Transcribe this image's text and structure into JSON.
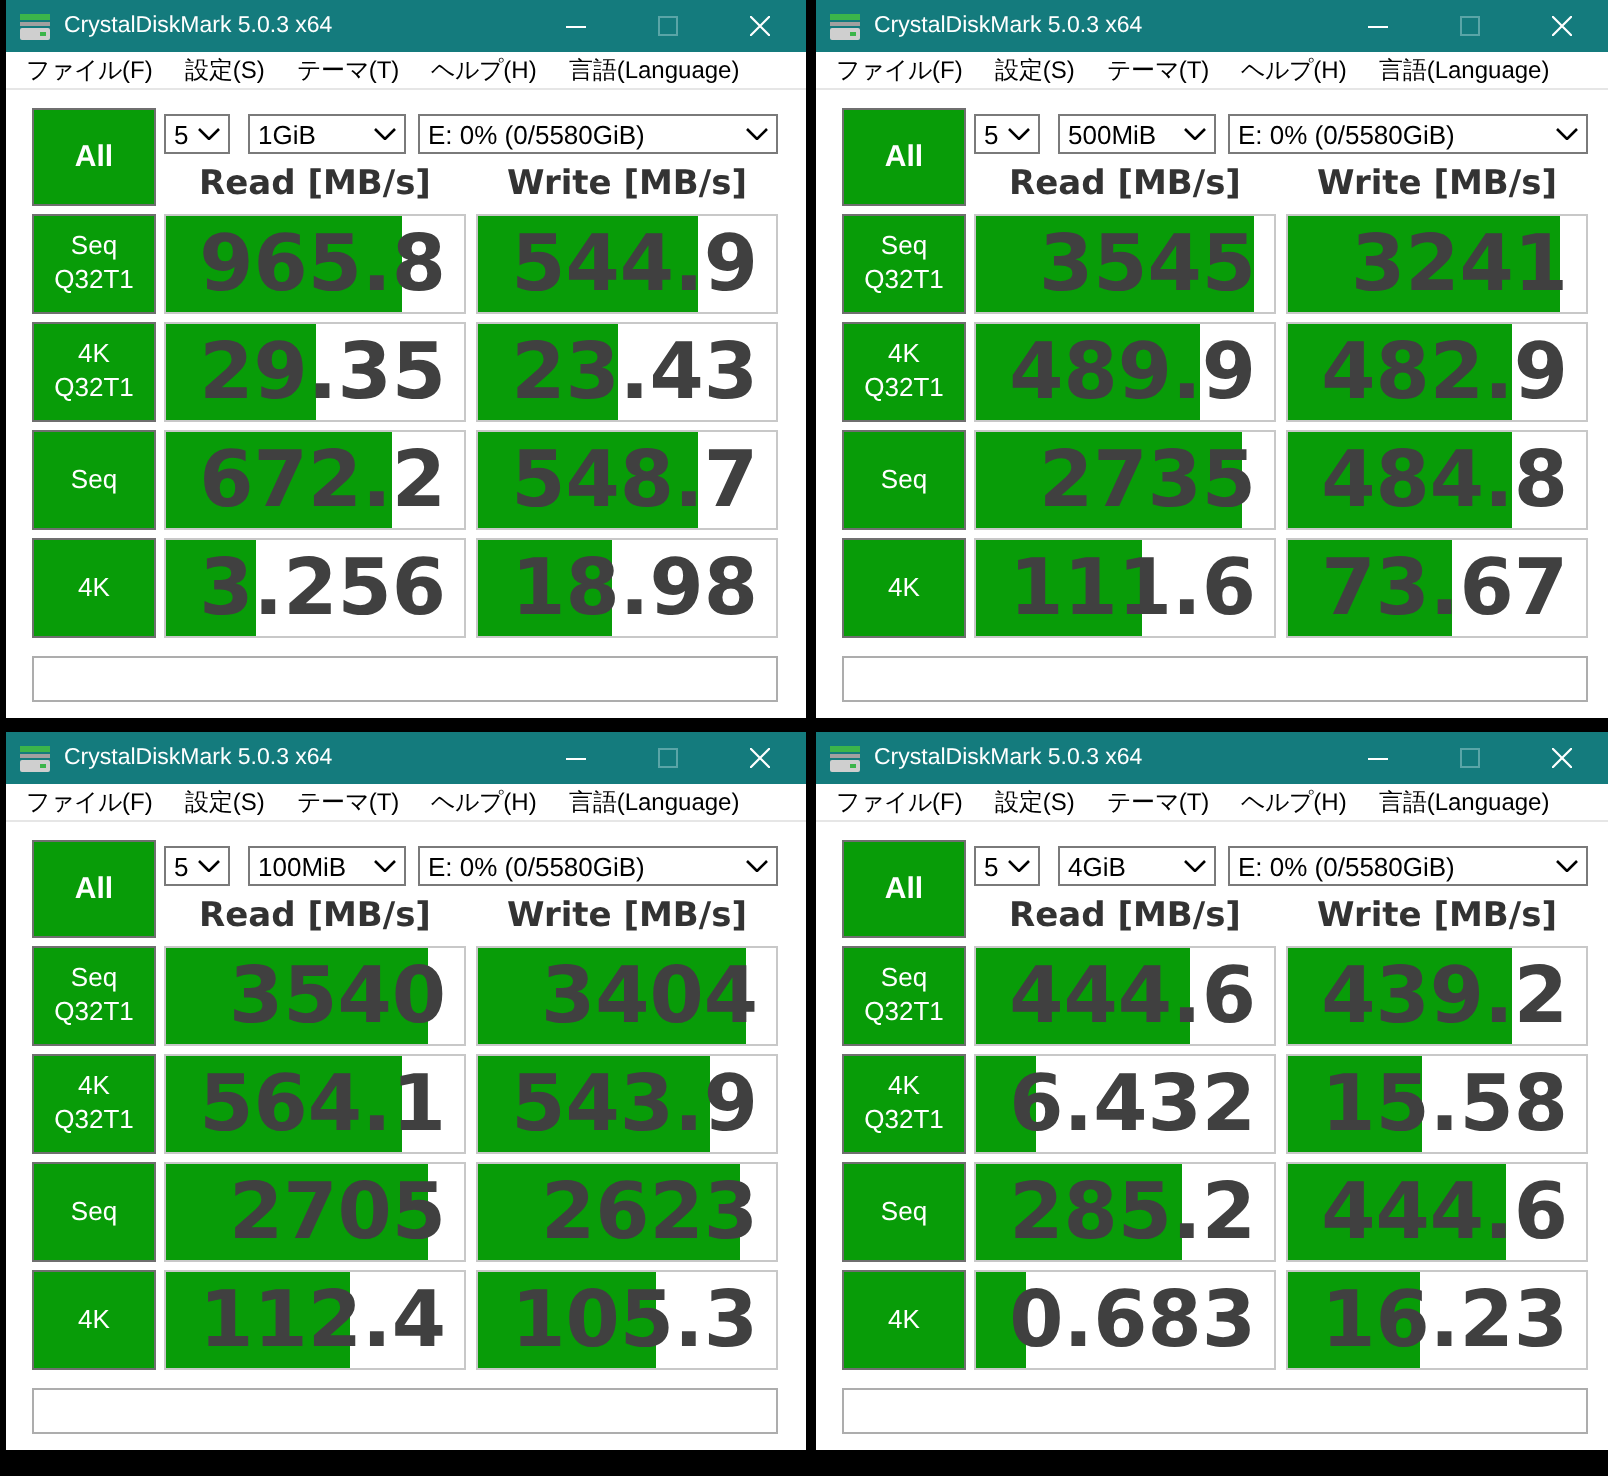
{
  "windows": [
    {
      "title": "CrystalDiskMark 5.0.3 x64",
      "maximize_disabled": true,
      "menu": [
        "ファイル(F)",
        "設定(S)",
        "テーマ(T)",
        "ヘルプ(H)",
        "言語(Language)"
      ],
      "all_button": "All",
      "count": "5",
      "size": "1GiB",
      "drive": "E: 0% (0/5580GiB)",
      "columns": [
        "Read [MB/s]",
        "Write [MB/s]"
      ],
      "rows": [
        {
          "label": "Seq Q32T1",
          "read": {
            "value": "965.8",
            "level": 0.79
          },
          "write": {
            "value": "544.9",
            "level": 0.74
          }
        },
        {
          "label": "4K Q32T1",
          "read": {
            "value": "29.35",
            "level": 0.5
          },
          "write": {
            "value": "23.43",
            "level": 0.47
          }
        },
        {
          "label": "Seq",
          "read": {
            "value": "672.2",
            "level": 0.76
          },
          "write": {
            "value": "548.7",
            "level": 0.74
          }
        },
        {
          "label": "4K",
          "read": {
            "value": "3.256",
            "level": 0.3
          },
          "write": {
            "value": "18.98",
            "level": 0.45
          }
        }
      ]
    },
    {
      "title": "CrystalDiskMark 5.0.3 x64",
      "maximize_disabled": true,
      "menu": [
        "ファイル(F)",
        "設定(S)",
        "テーマ(T)",
        "ヘルプ(H)",
        "言語(Language)"
      ],
      "all_button": "All",
      "count": "5",
      "size": "500MiB",
      "drive": "E: 0% (0/5580GiB)",
      "columns": [
        "Read [MB/s]",
        "Write [MB/s]"
      ],
      "rows": [
        {
          "label": "Seq Q32T1",
          "read": {
            "value": "3545",
            "level": 0.93
          },
          "write": {
            "value": "3241",
            "level": 0.91
          }
        },
        {
          "label": "4K Q32T1",
          "read": {
            "value": "489.9",
            "level": 0.75
          },
          "write": {
            "value": "482.9",
            "level": 0.75
          }
        },
        {
          "label": "Seq",
          "read": {
            "value": "2735",
            "level": 0.89
          },
          "write": {
            "value": "484.8",
            "level": 0.75
          }
        },
        {
          "label": "4K",
          "read": {
            "value": "111.6",
            "level": 0.56
          },
          "write": {
            "value": "73.67",
            "level": 0.55
          }
        }
      ]
    },
    {
      "title": "CrystalDiskMark 5.0.3 x64",
      "maximize_disabled": true,
      "menu": [
        "ファイル(F)",
        "設定(S)",
        "テーマ(T)",
        "ヘルプ(H)",
        "言語(Language)"
      ],
      "all_button": "All",
      "count": "5",
      "size": "100MiB",
      "drive": "E: 0% (0/5580GiB)",
      "columns": [
        "Read [MB/s]",
        "Write [MB/s]"
      ],
      "rows": [
        {
          "label": "Seq Q32T1",
          "read": {
            "value": "3540",
            "level": 0.88
          },
          "write": {
            "value": "3404",
            "level": 0.9
          }
        },
        {
          "label": "4K Q32T1",
          "read": {
            "value": "564.1",
            "level": 0.79
          },
          "write": {
            "value": "543.9",
            "level": 0.78
          }
        },
        {
          "label": "Seq",
          "read": {
            "value": "2705",
            "level": 0.88
          },
          "write": {
            "value": "2623",
            "level": 0.88
          }
        },
        {
          "label": "4K",
          "read": {
            "value": "112.4",
            "level": 0.62
          },
          "write": {
            "value": "105.3",
            "level": 0.6
          }
        }
      ]
    },
    {
      "title": "CrystalDiskMark 5.0.3 x64",
      "maximize_disabled": true,
      "menu": [
        "ファイル(F)",
        "設定(S)",
        "テーマ(T)",
        "ヘルプ(H)",
        "言語(Language)"
      ],
      "all_button": "All",
      "count": "5",
      "size": "4GiB",
      "drive": "E: 0% (0/5580GiB)",
      "columns": [
        "Read [MB/s]",
        "Write [MB/s]"
      ],
      "rows": [
        {
          "label": "Seq Q32T1",
          "read": {
            "value": "444.6",
            "level": 0.72
          },
          "write": {
            "value": "439.2",
            "level": 0.75
          }
        },
        {
          "label": "4K Q32T1",
          "read": {
            "value": "6.432",
            "level": 0.2
          },
          "write": {
            "value": "15.58",
            "level": 0.45
          }
        },
        {
          "label": "Seq",
          "read": {
            "value": "285.2",
            "level": 0.69
          },
          "write": {
            "value": "444.6",
            "level": 0.73
          }
        },
        {
          "label": "4K",
          "read": {
            "value": "0.683",
            "level": 0.17
          },
          "write": {
            "value": "16.23",
            "level": 0.44
          }
        }
      ]
    }
  ]
}
